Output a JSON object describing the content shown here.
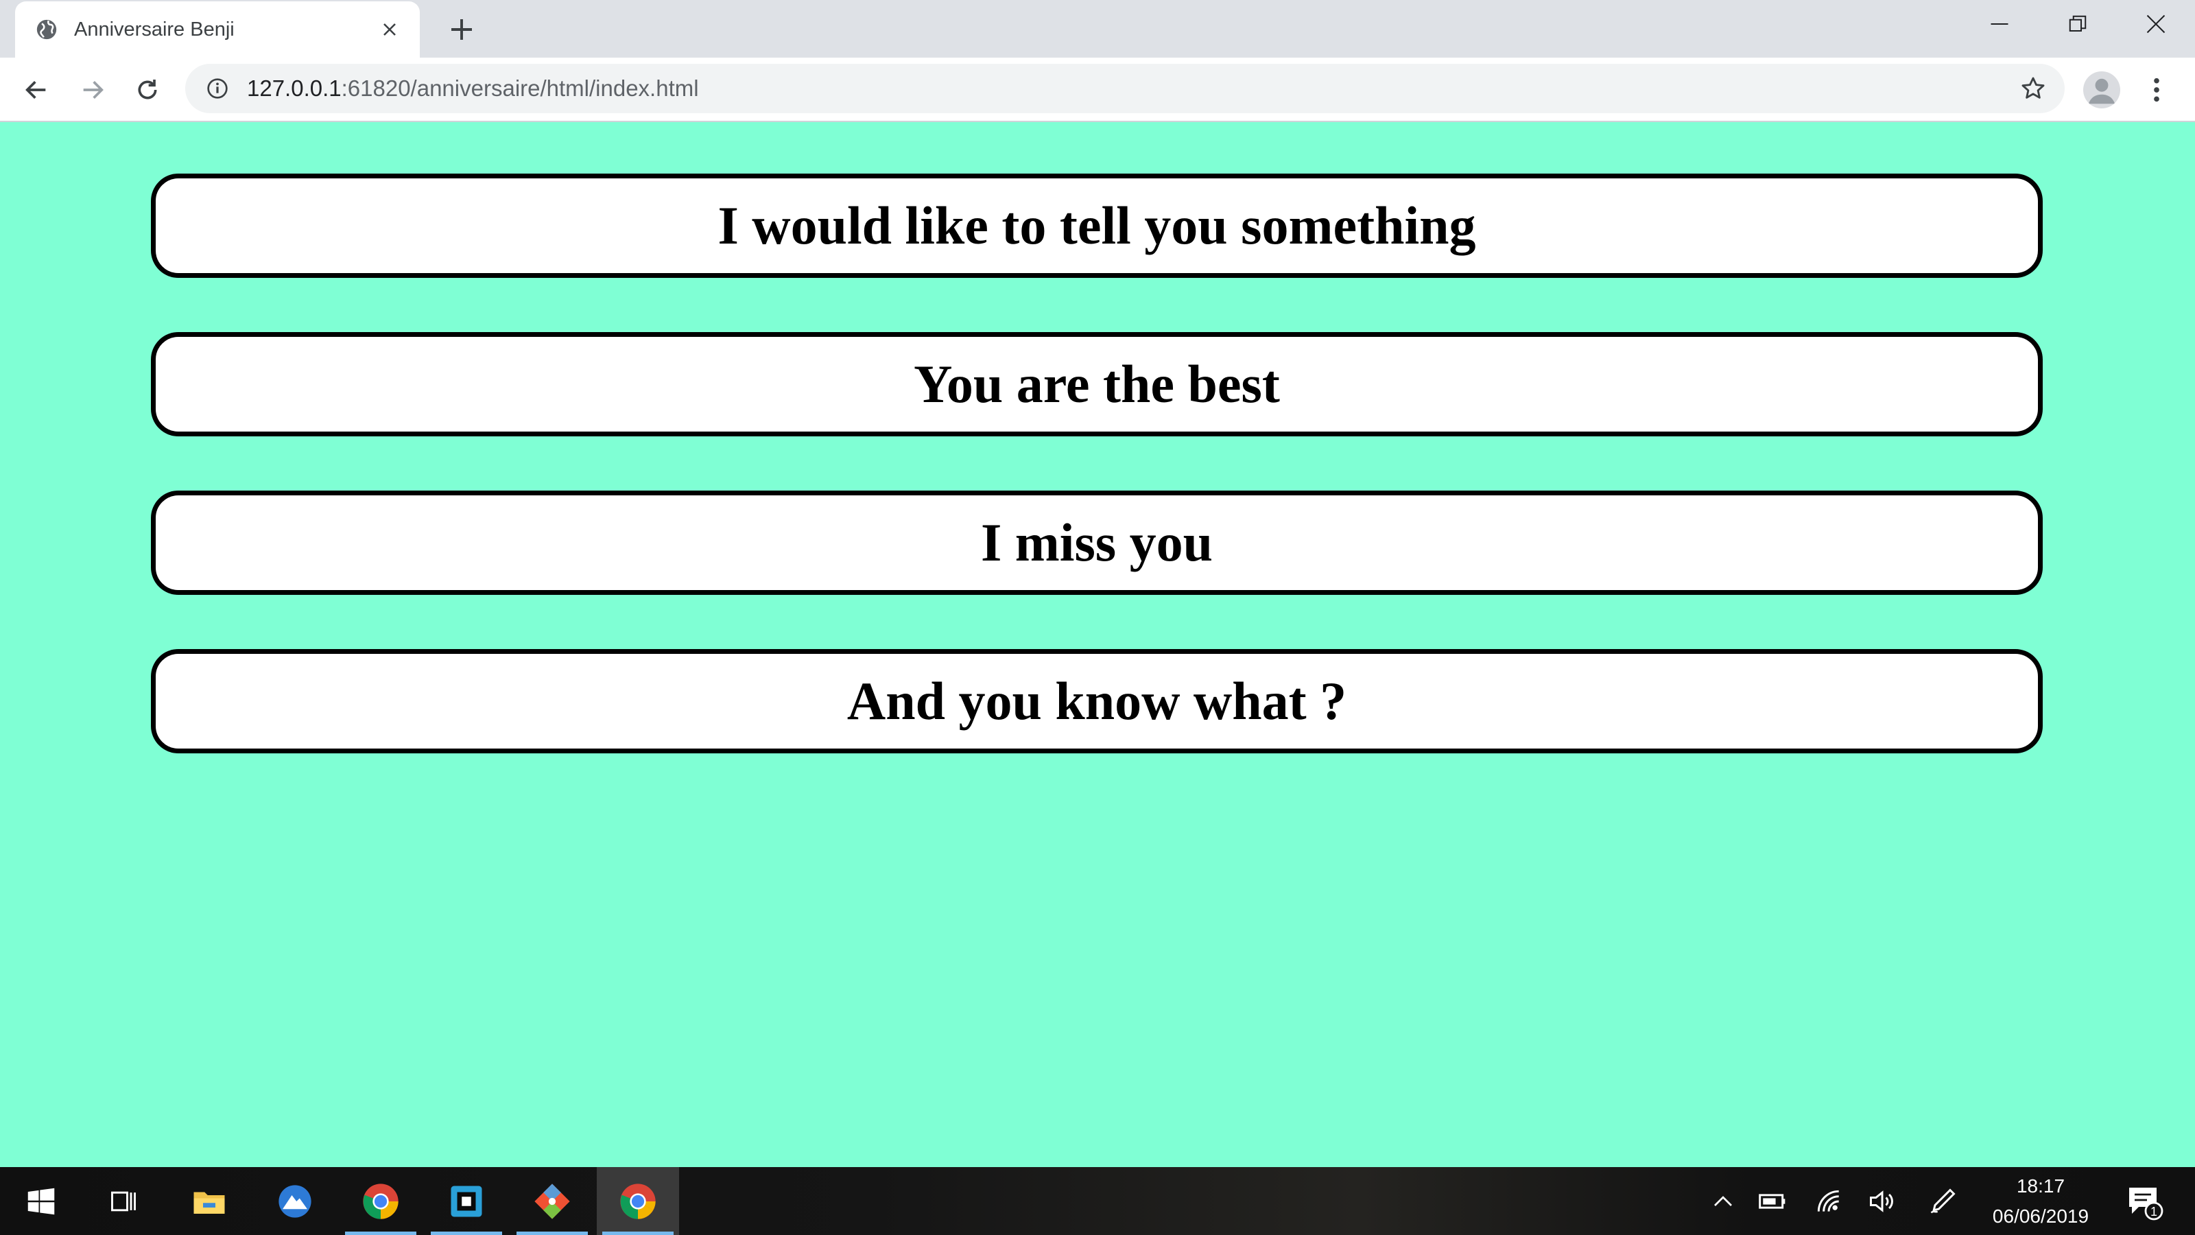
{
  "browser": {
    "tab": {
      "title": "Anniversaire Benji",
      "favicon": "globe-icon"
    },
    "address": {
      "host": "127.0.0.1",
      "rest": ":61820/anniversaire/html/index.html"
    },
    "icons": [
      "back-icon",
      "forward-icon",
      "reload-icon",
      "info-icon",
      "bookmark-star-icon",
      "profile-icon",
      "menu-icon"
    ]
  },
  "page": {
    "background": "#7fffd4",
    "messages": [
      "I would like to tell you something",
      "You are the best",
      "I miss you",
      "And you know what ?"
    ]
  },
  "taskbar": {
    "apps": [
      "start-button",
      "task-view",
      "file-explorer",
      "app-blue-circle",
      "chrome",
      "app-square",
      "git-app",
      "chrome-active"
    ],
    "clock": {
      "time": "18:17",
      "date": "06/06/2019"
    },
    "notifications_count": "1"
  }
}
